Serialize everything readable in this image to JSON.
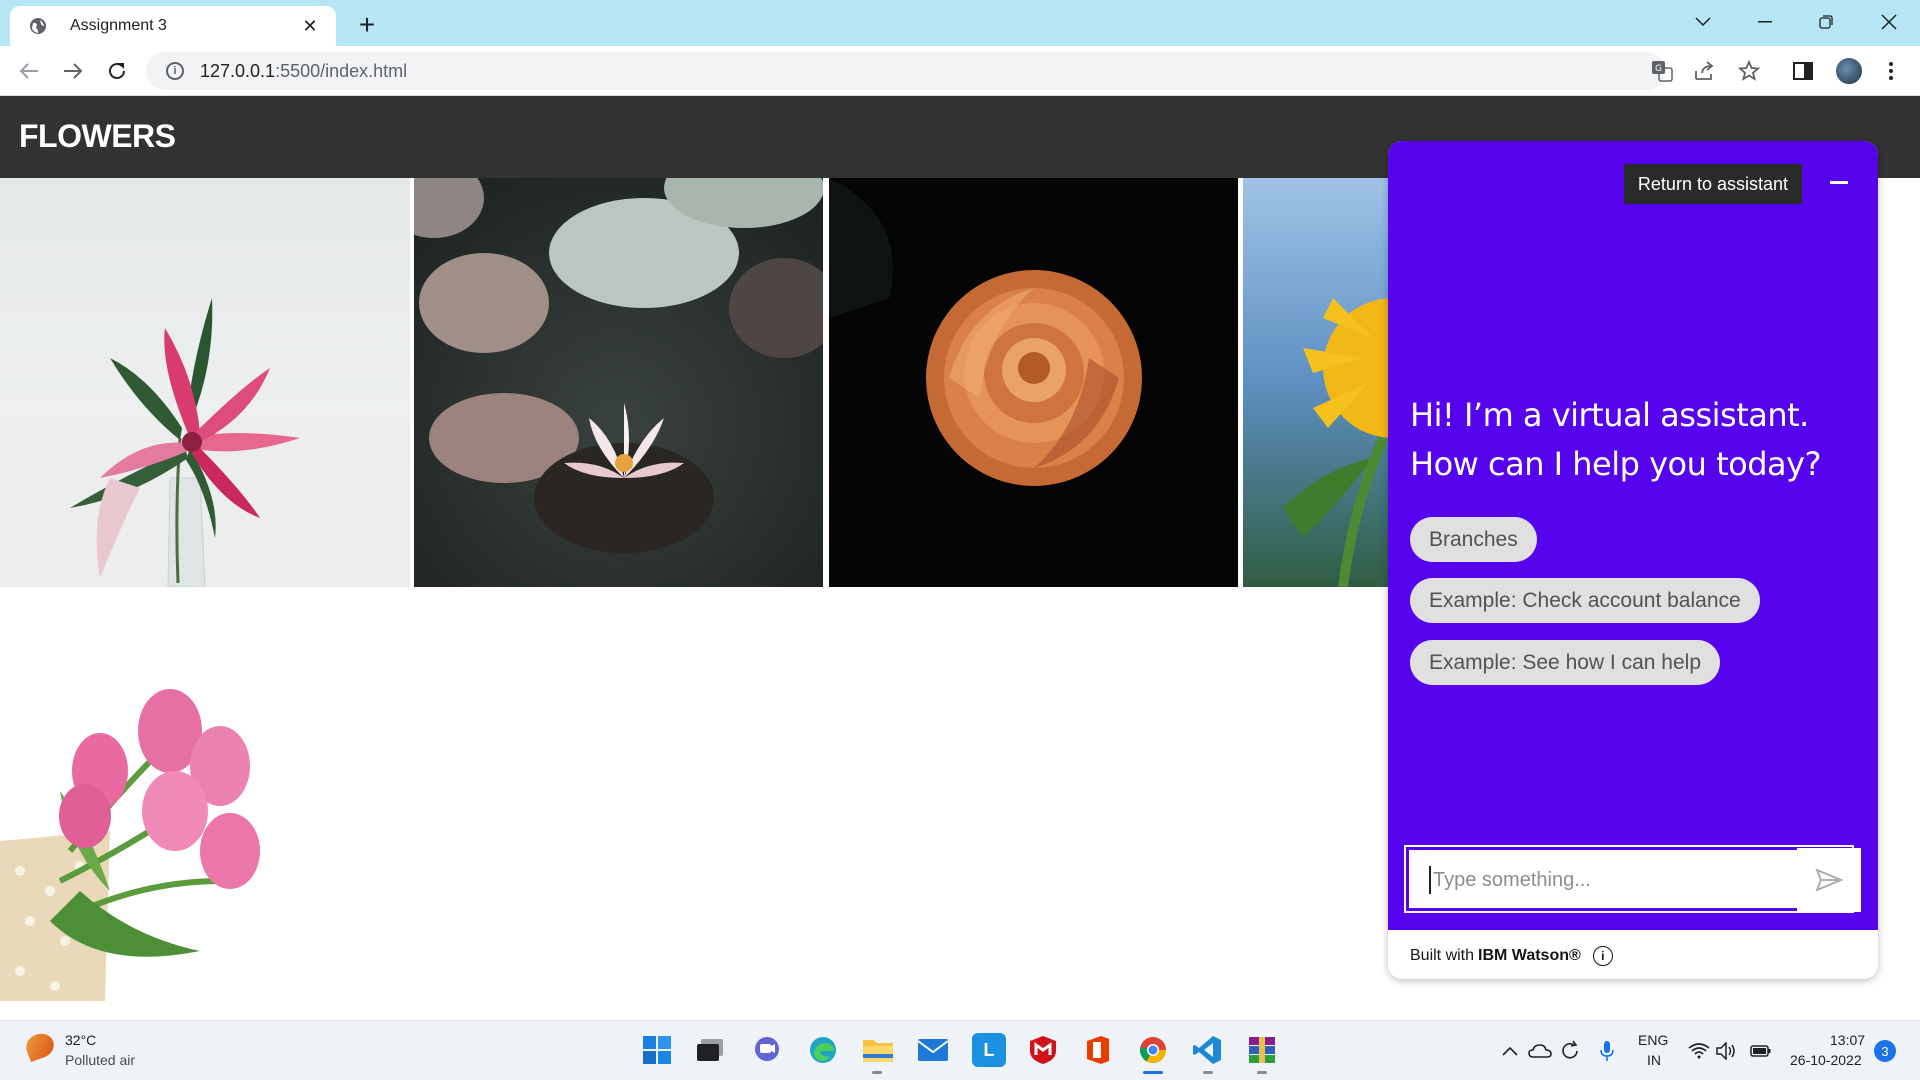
{
  "browser": {
    "tab_title": "Assignment 3",
    "url_host": "127.0.0.1",
    "url_path": ":5500/index.html",
    "icons": [
      "globe-icon",
      "close-icon",
      "plus-icon",
      "chevron-down-icon",
      "minimize-icon",
      "restore-icon",
      "close-window-icon",
      "back-icon",
      "forward-icon",
      "reload-icon",
      "info-icon",
      "translate-icon",
      "share-icon",
      "star-icon",
      "side-panel-icon",
      "menu-icon"
    ]
  },
  "page": {
    "title": "FLOWERS",
    "photos": [
      "pink-lily",
      "water-lily",
      "orange-rose",
      "sunflower",
      "pink-tulips"
    ]
  },
  "assistant": {
    "return_label": "Return to assistant",
    "greeting": "Hi! I’m a virtual assistant. How can I help you today?",
    "options": [
      "Branches",
      "Example: Check account balance",
      "Example: See how I can help"
    ],
    "input_placeholder": "Type something...",
    "footer_prefix": "Built with",
    "footer_brand": "IBM Watson®",
    "accent_color": "#5603ee"
  },
  "taskbar": {
    "temperature": "32°C",
    "weather": "Polluted air",
    "lang_primary": "ENG",
    "lang_secondary": "IN",
    "time": "13:07",
    "date": "26-10-2022",
    "notifications": "3"
  }
}
